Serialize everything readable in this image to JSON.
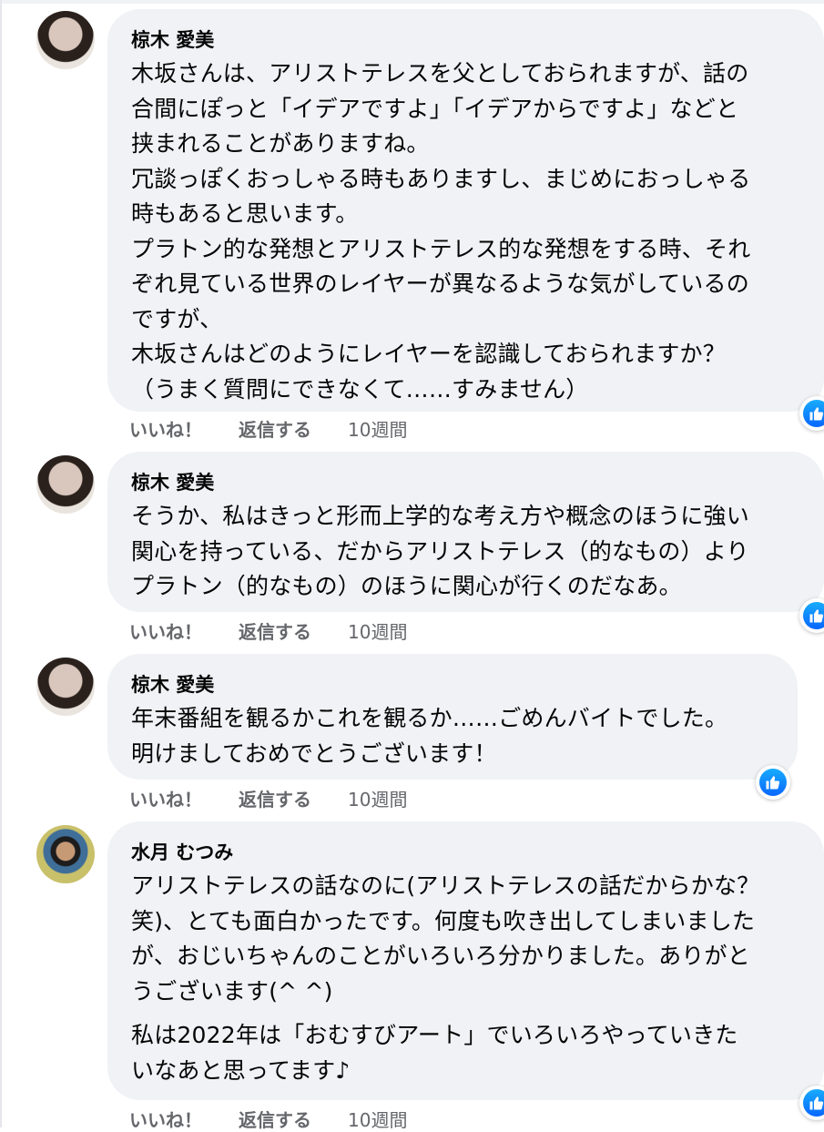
{
  "comments": [
    {
      "author": "椋木 愛美",
      "text": "木坂さんは、アリストテレスを父としておられますが、話の\n合間にぽっと「イデアですよ」「イデアからですよ」などと\n挟まれることがありますね。\n冗談っぽくおっしゃる時もありますし、まじめにおっしゃる\n時もあると思います。\nプラトン的な発想とアリストテレス的な発想をする時、それ\nぞれ見ている世界のレイヤーが異なるような気がしているの\nですが、\n木坂さんはどのようにレイヤーを認識しておられますか？\n（うまく質問にできなくて……すみません）",
      "like_label": "いいね！",
      "reply_label": "返信する",
      "time": "10週間",
      "reaction_icon": "like-reaction-icon"
    },
    {
      "author": "椋木 愛美",
      "text": "そうか、私はきっと形而上学的な考え方や概念のほうに強い\n関心を持っている、だからアリストテレス（的なもの）より\nプラトン（的なもの）のほうに関心が行くのだなあ。",
      "like_label": "いいね！",
      "reply_label": "返信する",
      "time": "10週間",
      "reaction_icon": "like-reaction-icon"
    },
    {
      "author": "椋木 愛美",
      "text": "年末番組を観るかこれを観るか……ごめんバイトでした。\n明けましておめでとうございます！",
      "like_label": "いいね！",
      "reply_label": "返信する",
      "time": "10週間",
      "reaction_icon": "like-reaction-icon"
    },
    {
      "author": "水月 むつみ",
      "text": "アリストテレスの話なのに(アリストテレスの話だからかな？\n笑)、とても面白かったです。何度も吹き出してしまいました\nが、おじいちゃんのことがいろいろ分かりました。ありがと\nうございます(^ ^)",
      "text2": "私は2022年は「おむすびアート」でいろいろやっていきた\nいなあと思ってます♪",
      "like_label": "いいね！",
      "reply_label": "返信する",
      "time": "10週間",
      "reaction_icon": "like-reaction-icon"
    }
  ],
  "colors": {
    "bubble": "#f0f2f5",
    "action_text": "#65676b",
    "like_blue": "#0866ff"
  }
}
